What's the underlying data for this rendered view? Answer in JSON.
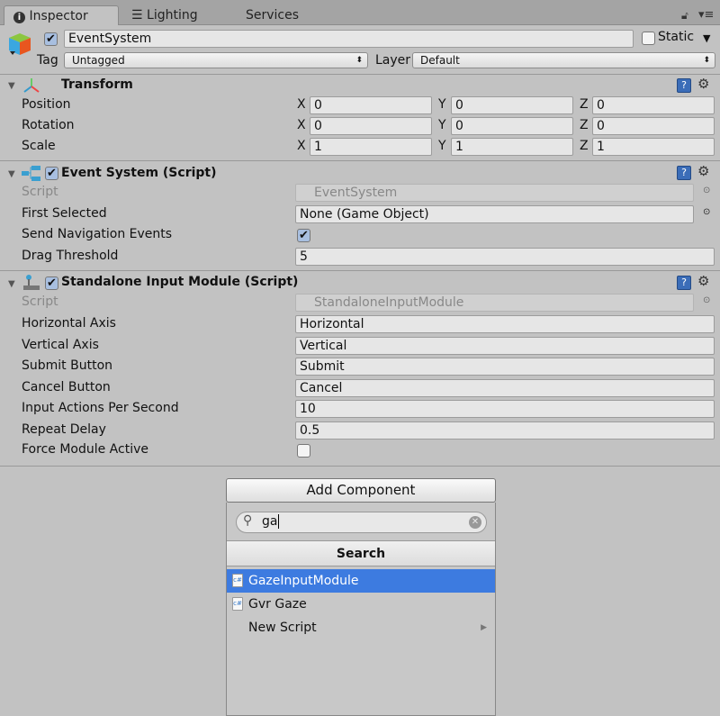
{
  "tabs": [
    {
      "label": "Inspector",
      "icon": "info-icon"
    },
    {
      "label": "Lighting",
      "icon": "sliders-icon"
    },
    {
      "label": "Services"
    }
  ],
  "object": {
    "name": "EventSystem",
    "active": true,
    "static_label": "Static",
    "static": false,
    "tag_label": "Tag",
    "tag": "Untagged",
    "layer_label": "Layer",
    "layer": "Default"
  },
  "transform": {
    "title": "Transform",
    "rows": [
      {
        "label": "Position",
        "x": "0",
        "y": "0",
        "z": "0"
      },
      {
        "label": "Rotation",
        "x": "0",
        "y": "0",
        "z": "0"
      },
      {
        "label": "Scale",
        "x": "1",
        "y": "1",
        "z": "1"
      }
    ],
    "axes": [
      "X",
      "Y",
      "Z"
    ]
  },
  "event_system": {
    "title": "Event System (Script)",
    "enabled": true,
    "script_label": "Script",
    "script": "EventSystem",
    "first_selected_label": "First Selected",
    "first_selected": "None (Game Object)",
    "send_nav_label": "Send Navigation Events",
    "send_nav": true,
    "drag_label": "Drag Threshold",
    "drag": "5"
  },
  "standalone": {
    "title": "Standalone Input Module (Script)",
    "enabled": true,
    "script_label": "Script",
    "script": "StandaloneInputModule",
    "rows": [
      {
        "label": "Horizontal Axis",
        "value": "Horizontal"
      },
      {
        "label": "Vertical Axis",
        "value": "Vertical"
      },
      {
        "label": "Submit Button",
        "value": "Submit"
      },
      {
        "label": "Cancel Button",
        "value": "Cancel"
      },
      {
        "label": "Input Actions Per Second",
        "value": "10"
      },
      {
        "label": "Repeat Delay",
        "value": "0.5"
      }
    ],
    "force_label": "Force Module Active",
    "force": false
  },
  "add_component": {
    "button": "Add Component",
    "search_value": "ga",
    "header": "Search",
    "items": [
      {
        "label": "GazeInputModule",
        "selected": true
      },
      {
        "label": "Gvr Gaze"
      },
      {
        "label": "New Script",
        "submenu": true
      }
    ]
  },
  "colors": {
    "selection": "#3d7be0",
    "panel": "#c2c2c2"
  }
}
